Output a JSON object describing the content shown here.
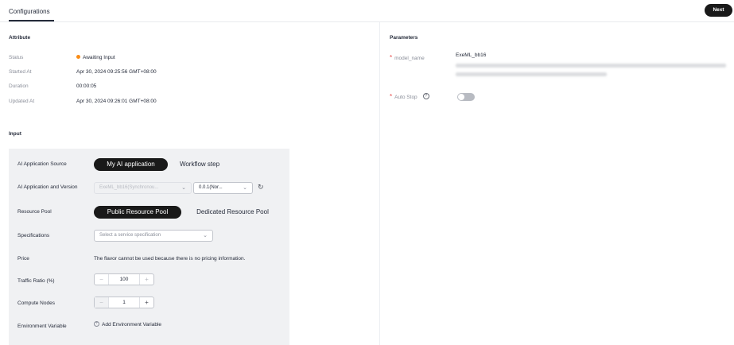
{
  "tabs": {
    "active_label": "Configurations"
  },
  "actions": {
    "next_label": "Next"
  },
  "attribute": {
    "title": "Attribute",
    "rows": [
      {
        "label": "Status",
        "value": "Awaiting Input"
      },
      {
        "label": "Started At",
        "value": "Apr 30, 2024 09:25:56 GMT+08:00"
      },
      {
        "label": "Duration",
        "value": "00:00:05"
      },
      {
        "label": "Updated At",
        "value": "Apr 30, 2024 09:26:01 GMT+08:00"
      }
    ],
    "status_color": "#fa8c16"
  },
  "input": {
    "title": "Input",
    "source": {
      "label": "AI Application Source",
      "options": [
        "My AI application",
        "Workflow step"
      ],
      "selected": "My AI application"
    },
    "app_version": {
      "label": "AI Application and Version",
      "app_value": "ExeML_bb16(Synchronou...",
      "version_value": "0.0.1(Nor..."
    },
    "resource_pool": {
      "label": "Resource Pool",
      "options": [
        "Public Resource Pool",
        "Dedicated Resource Pool"
      ],
      "selected": "Public Resource Pool"
    },
    "specifications": {
      "label": "Specifications",
      "placeholder": "Select a service specification"
    },
    "price": {
      "label": "Price",
      "text": "The flavor cannot be used because there is no pricing information."
    },
    "traffic_ratio": {
      "label": "Traffic Ratio (%)",
      "value": "100"
    },
    "compute_nodes": {
      "label": "Compute Nodes",
      "value": "1"
    },
    "env_var": {
      "label": "Environment Variable",
      "action": "Add Environment Variable"
    }
  },
  "parameters": {
    "title": "Parameters",
    "model_name": {
      "label": "model_name",
      "value": "ExeML_bb16"
    },
    "auto_stop": {
      "label": "Auto Stop",
      "enabled": false
    }
  },
  "icons": {
    "chevron": "chevron-down-icon",
    "refresh": "refresh-icon",
    "help": "help-icon",
    "add": "plus-circle-icon"
  },
  "colors": {
    "primary_dark": "#191919",
    "required": "#e54545",
    "panel_bg": "#f0f1f3"
  }
}
